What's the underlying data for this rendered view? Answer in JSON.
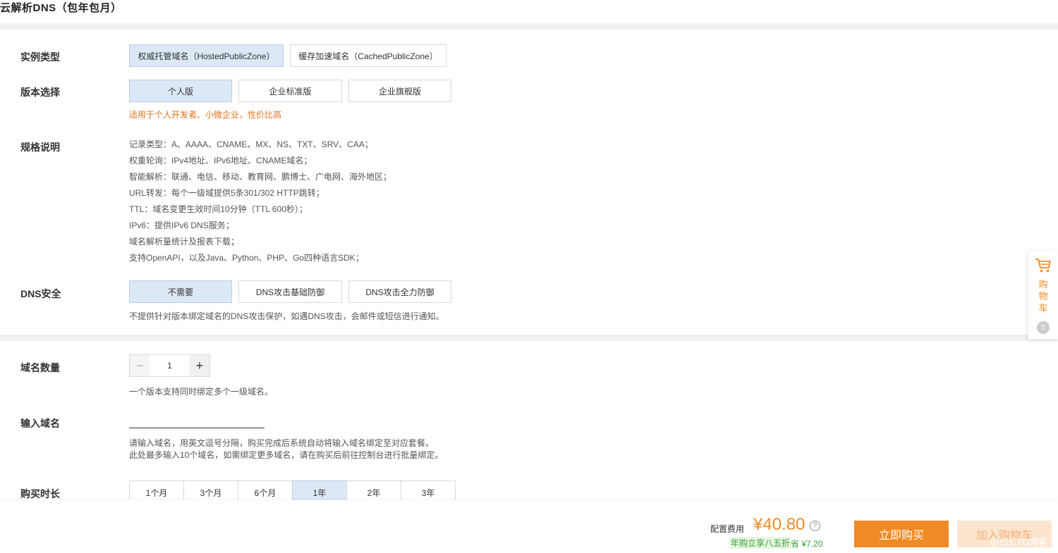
{
  "page": {
    "title": "云解析DNS（包年包月）"
  },
  "instance_type": {
    "label": "实例类型",
    "options": [
      "权威托管域名（HostedPublicZone）",
      "缓存加速域名（CachedPublicZone）"
    ],
    "selected": 0
  },
  "edition": {
    "label": "版本选择",
    "options": [
      "个人版",
      "企业标准版",
      "企业旗舰版"
    ],
    "selected": 0,
    "hint": "适用于个人开发者、小微企业，性价比高"
  },
  "spec": {
    "label": "规格说明",
    "lines": [
      "记录类型：A、AAAA、CNAME、MX、NS、TXT、SRV、CAA；",
      "权重轮询：IPv4地址、IPv6地址、CNAME域名；",
      "智能解析：联通、电信、移动、教育网、鹏博士、广电网、海外地区；",
      "URL转发：每个一级域提供5条301/302 HTTP跳转；",
      "TTL：域名变更生效时间10分钟（TTL 600秒）；",
      "IPv6：提供IPv6 DNS服务；",
      "域名解析量统计及报表下载；",
      "支持OpenAPI，以及Java、Python、PHP、Go四种语言SDK；"
    ]
  },
  "dns_security": {
    "label": "DNS安全",
    "options": [
      "不需要",
      "DNS攻击基础防御",
      "DNS攻击全力防御"
    ],
    "selected": 0,
    "hint": "不提供针对版本绑定域名的DNS攻击保护，如遇DNS攻击，会邮件或短信进行通知。"
  },
  "domain_count": {
    "label": "域名数量",
    "minus": "−",
    "plus": "+",
    "value": "1",
    "hint": "一个版本支持同时绑定多个一级域名。"
  },
  "domain_input": {
    "label": "输入域名",
    "value": "",
    "hint1": "请输入域名，用英文逗号分隔，购买完成后系统自动将输入域名绑定至对应套餐。",
    "hint2": "此处最多输入10个域名，如需绑定更多域名，请在购买后前往控制台进行批量绑定。"
  },
  "duration": {
    "label": "购买时长",
    "options": [
      "1个月",
      "3个月",
      "6个月",
      "1年",
      "2年",
      "3年"
    ],
    "selected": 3
  },
  "footer": {
    "fee_label": "配置费用",
    "price": "¥40.80",
    "help": "?",
    "discount": "年购立享八五折",
    "save": "省 ¥7.20",
    "buy_now": "立即购买",
    "add_cart": "加入购物车",
    "watermark": "@51CTO博客"
  },
  "float_cart": {
    "label": "购物车",
    "count": "0"
  },
  "colors": {
    "accent": "#f08a24",
    "selected_bg": "#dce8f5",
    "discount_green": "#3aa13a"
  }
}
